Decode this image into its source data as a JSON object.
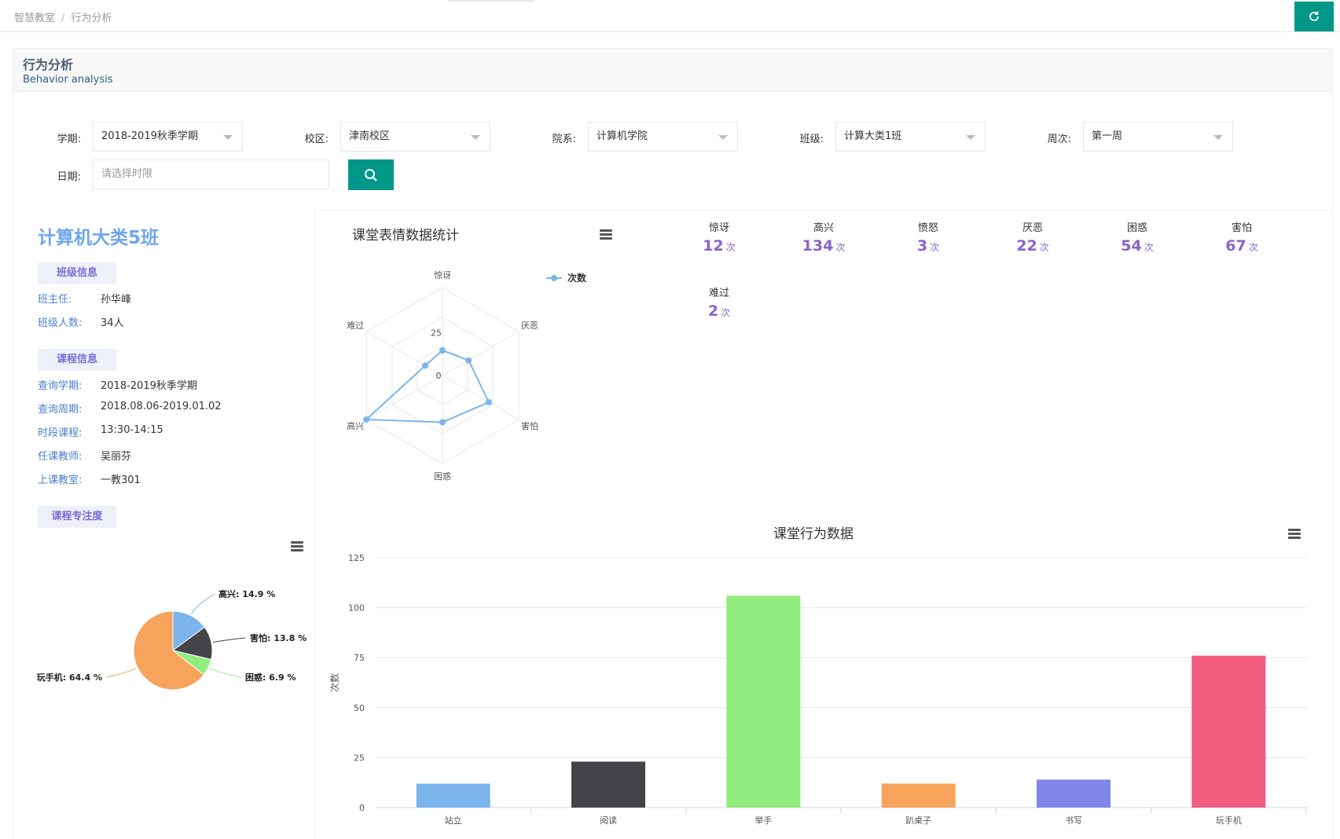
{
  "breadcrumb": {
    "home": "智慧教室",
    "separator": "/",
    "current": "行为分析"
  },
  "header": {
    "title": "行为分析",
    "subtitle": "Behavior analysis"
  },
  "filters": {
    "semester": {
      "label": "学期:",
      "value": "2018-2019秋季学期"
    },
    "campus": {
      "label": "校区:",
      "value": "津南校区"
    },
    "college": {
      "label": "院系:",
      "value": "计算机学院"
    },
    "class": {
      "label": "班级:",
      "value": "计算大类1班"
    },
    "week": {
      "label": "周次:",
      "value": "第一周"
    },
    "date": {
      "label": "日期:",
      "placeholder": "请选择时限"
    }
  },
  "class_panel": {
    "class_name": "计算机大类5班",
    "class_info_tag": "班级信息",
    "head_teacher": {
      "label": "班主任:",
      "value": "孙华峰"
    },
    "student_count": {
      "label": "班级人数:",
      "value": "34人"
    },
    "course_info_tag": "课程信息",
    "query_semester": {
      "label": "查询学期:",
      "value": "2018-2019秋季学期"
    },
    "query_period": {
      "label": "查询周期:",
      "value": "2018.08.06-2019.01.02"
    },
    "time_slot": {
      "label": "时段课程:",
      "value": "13:30-14:15"
    },
    "teacher": {
      "label": "任课教师:",
      "value": "吴丽芬"
    },
    "classroom": {
      "label": "上课教室:",
      "value": "一教301"
    },
    "focus_tag": "课程专注度"
  },
  "expression_stats": {
    "title": "课堂表情数据统计",
    "unit": "次",
    "items": [
      {
        "label": "惊讶",
        "value": "12"
      },
      {
        "label": "高兴",
        "value": "134"
      },
      {
        "label": "愤怒",
        "value": "3"
      },
      {
        "label": "厌恶",
        "value": "22"
      },
      {
        "label": "困惑",
        "value": "54"
      },
      {
        "label": "害怕",
        "value": "67"
      },
      {
        "label": "难过",
        "value": "2"
      }
    ]
  },
  "colors": {
    "accent": "#009688",
    "class_name": "#6fa6ea",
    "stat_purple": "#8a63c8",
    "radar_line": "#7cb5ec"
  },
  "chart_data": [
    {
      "type": "radar",
      "axes": [
        "惊讶",
        "厌恶",
        "害怕",
        "困惑",
        "高兴",
        "难过"
      ],
      "tick_labels": [
        "0",
        "25"
      ],
      "series": [
        {
          "name": "次数",
          "values": [
            12,
            22,
            67,
            54,
            134,
            2
          ]
        }
      ],
      "legend": "right",
      "color": "#7cb5ec"
    },
    {
      "type": "pie",
      "slices": [
        {
          "name": "高兴",
          "value": 14.9,
          "label": "高兴: 14.9 %",
          "color": "#7cb5ec"
        },
        {
          "name": "害怕",
          "value": 13.8,
          "label": "害怕: 13.8 %",
          "color": "#434348"
        },
        {
          "name": "困惑",
          "value": 6.9,
          "label": "困惑: 6.9 %",
          "color": "#90ed7d"
        },
        {
          "name": "玩手机",
          "value": 64.4,
          "label": "玩手机: 64.4 %",
          "color": "#f7a35c"
        }
      ]
    },
    {
      "type": "bar",
      "title": "课堂行为数据",
      "ylabel": "次数",
      "xlabel": "",
      "categories": [
        "站立",
        "阅读",
        "举手",
        "趴桌子",
        "书写",
        "玩手机"
      ],
      "values": [
        12,
        23,
        106,
        12,
        14,
        76
      ],
      "colors": [
        "#7cb5ec",
        "#434348",
        "#90ed7d",
        "#f7a35c",
        "#8085e9",
        "#f15c80"
      ],
      "ylim": [
        0,
        125
      ],
      "yticks": [
        0,
        25,
        50,
        75,
        100,
        125
      ],
      "grid": true
    }
  ]
}
